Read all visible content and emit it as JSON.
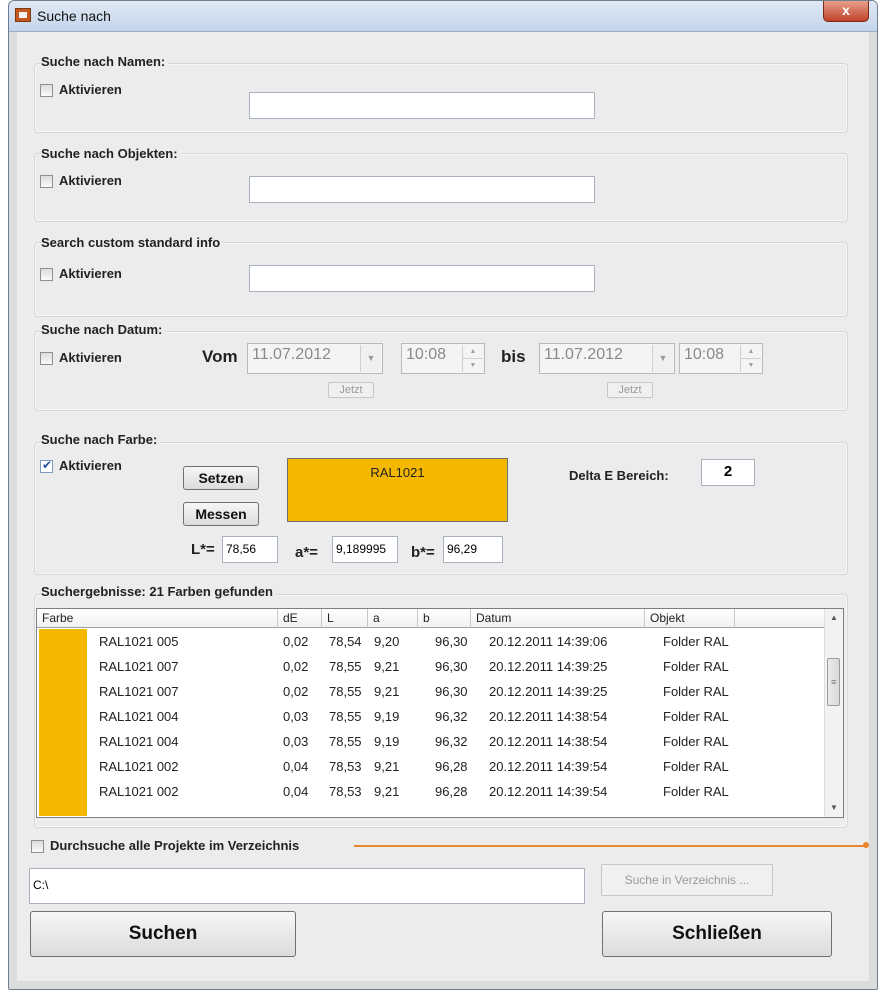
{
  "window": {
    "title": "Suche nach",
    "close_glyph": "x"
  },
  "groups": {
    "name": {
      "label": "Suche nach Namen:",
      "activate": "Aktivieren",
      "value": ""
    },
    "objects": {
      "label": "Suche nach Objekten:",
      "activate": "Aktivieren",
      "value": ""
    },
    "custom": {
      "label": "Search custom standard info",
      "activate": "Aktivieren",
      "value": ""
    },
    "date": {
      "label": "Suche nach Datum:",
      "activate": "Aktivieren",
      "from_label": "Vom",
      "from_date": "11.07.2012",
      "from_time": "10:08",
      "to_label": "bis",
      "to_date": "11.07.2012",
      "to_time": "10:08",
      "now_label": "Jetzt"
    },
    "color": {
      "label": "Suche nach Farbe:",
      "activate": "Aktivieren",
      "checked": true,
      "set_button": "Setzen",
      "measure_button": "Messen",
      "swatch_name": "RAL1021",
      "swatch_color": "#f5b800",
      "delta_label": "Delta E Bereich:",
      "delta_value": "2",
      "l_label": "L*=",
      "l_value": "78,56",
      "a_label": "a*=",
      "a_value": "9,189995",
      "b_label": "b*=",
      "b_value": "96,29"
    }
  },
  "results": {
    "label": "Suchergebnisse: 21 Farben gefunden",
    "columns": [
      "Farbe",
      "dE",
      "L",
      "a",
      "b",
      "Datum",
      "Objekt"
    ],
    "rows": [
      {
        "name": "RAL1021 005",
        "dE": "0,02",
        "L": "78,54",
        "a": "9,20",
        "b": "96,30",
        "datum": "20.12.2011 14:39:06",
        "objekt": "Folder RAL"
      },
      {
        "name": "RAL1021 007",
        "dE": "0,02",
        "L": "78,55",
        "a": "9,21",
        "b": "96,30",
        "datum": "20.12.2011 14:39:25",
        "objekt": "Folder RAL"
      },
      {
        "name": "RAL1021 007",
        "dE": "0,02",
        "L": "78,55",
        "a": "9,21",
        "b": "96,30",
        "datum": "20.12.2011 14:39:25",
        "objekt": "Folder RAL"
      },
      {
        "name": "RAL1021 004",
        "dE": "0,03",
        "L": "78,55",
        "a": "9,19",
        "b": "96,32",
        "datum": "20.12.2011 14:38:54",
        "objekt": "Folder RAL"
      },
      {
        "name": "RAL1021 004",
        "dE": "0,03",
        "L": "78,55",
        "a": "9,19",
        "b": "96,32",
        "datum": "20.12.2011 14:38:54",
        "objekt": "Folder RAL"
      },
      {
        "name": "RAL1021 002",
        "dE": "0,04",
        "L": "78,53",
        "a": "9,21",
        "b": "96,28",
        "datum": "20.12.2011 14:39:54",
        "objekt": "Folder RAL"
      },
      {
        "name": "RAL1021 002",
        "dE": "0,04",
        "L": "78,53",
        "a": "9,21",
        "b": "96,28",
        "datum": "20.12.2011 14:39:54",
        "objekt": "Folder RAL"
      }
    ],
    "row_color": "#f5b800"
  },
  "directory": {
    "search_all_label": "Durchsuche alle Projekte im Verzeichnis",
    "path_value": "C:\\",
    "search_dir_button": "Suche in Verzeichnis ..."
  },
  "actions": {
    "search_button": "Suchen",
    "close_button": "Schließen"
  },
  "colors": {
    "accent_orange": "#e8872c"
  }
}
